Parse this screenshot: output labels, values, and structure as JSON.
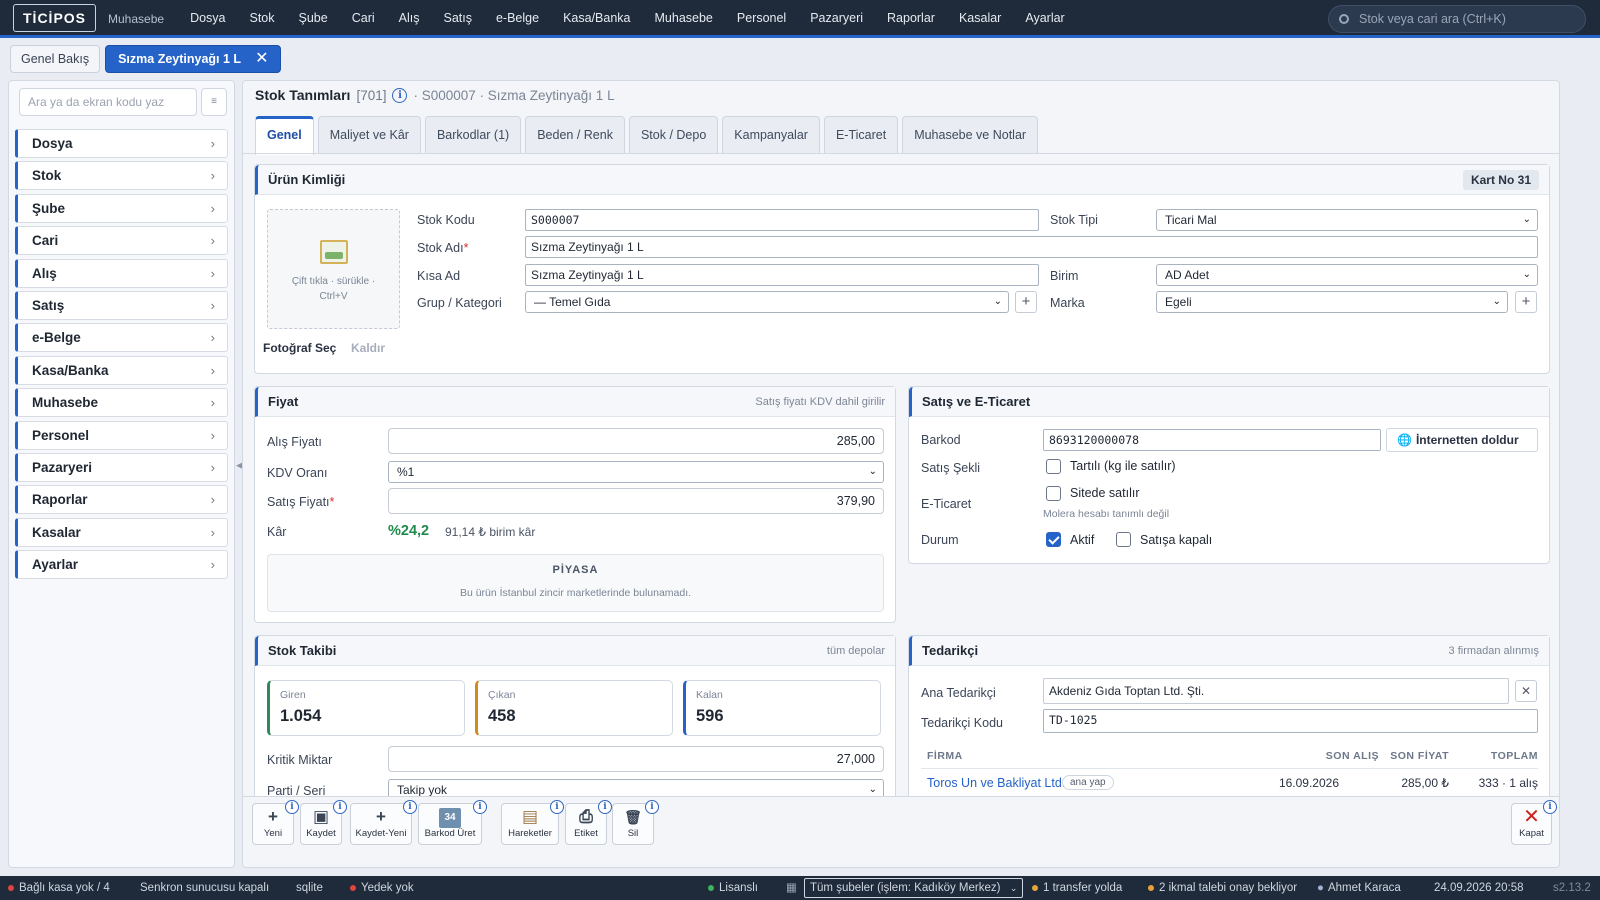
{
  "app": {
    "logo": "TİCİPOS",
    "module": "Muhasebe"
  },
  "nav": [
    "Dosya",
    "Stok",
    "Şube",
    "Cari",
    "Alış",
    "Satış",
    "e-Belge",
    "Kasa/Banka",
    "Muhasebe",
    "Personel",
    "Pazaryeri",
    "Raporlar",
    "Kasalar",
    "Ayarlar"
  ],
  "search": {
    "placeholder": "Stok veya cari ara (Ctrl+K)"
  },
  "page_tabs": [
    {
      "label": "Genel Bakış"
    },
    {
      "label": "Sızma Zeytinyağı 1 L",
      "close": "✕"
    }
  ],
  "sidebar": {
    "search_placeholder": "Ara ya da ekran kodu yaz",
    "button": "≡",
    "items": [
      "Dosya",
      "Stok",
      "Şube",
      "Cari",
      "Alış",
      "Satış",
      "e-Belge",
      "Kasa/Banka",
      "Muhasebe",
      "Personel",
      "Pazaryeri",
      "Raporlar",
      "Kasalar",
      "Ayarlar"
    ],
    "chevron": "›"
  },
  "header": {
    "title": "Stok Tanımları",
    "code": "[701]",
    "info": "i",
    "path": "· S000007 · Sızma Zeytinyağı 1 L"
  },
  "content_tabs": [
    "Genel",
    "Maliyet ve Kâr",
    "Barkodlar (1)",
    "Beden / Renk",
    "Stok / Depo",
    "Kampanyalar",
    "E-Ticaret",
    "Muhasebe ve Notlar"
  ],
  "identity": {
    "title": "Ürün Kimliği",
    "kart_no": "Kart No 31",
    "photo_hint_1": "Çift tıkla · sürükle ·",
    "photo_hint_2": "Ctrl+V",
    "photo_select": "Fotoğraf Seç",
    "photo_remove": "Kaldır",
    "stok_kodu_label": "Stok Kodu",
    "stok_kodu": "S000007",
    "stok_adi_label": "Stok Adı",
    "stok_adi": "Sızma Zeytinyağı 1 L",
    "required": "*",
    "kisa_ad_label": "Kısa Ad",
    "kisa_ad": "Sızma Zeytinyağı 1 L",
    "grup_label": "Grup / Kategori",
    "grup": "— Temel Gıda",
    "stok_tipi_label": "Stok Tipi",
    "stok_tipi": "Ticari Mal",
    "birim_label": "Birim",
    "birim": "AD Adet",
    "marka_label": "Marka",
    "marka": "Egeli",
    "plus": "+"
  },
  "price": {
    "title": "Fiyat",
    "hint": "Satış fiyatı KDV dahil girilir",
    "alis_label": "Alış Fiyatı",
    "alis": "285,00",
    "kdv_label": "KDV Oranı",
    "kdv": "%1",
    "satis_label": "Satış Fiyatı",
    "satis": "379,90",
    "kar_label": "Kâr",
    "kar_pct": "%24,2",
    "kar_unit": "91,14 ₺ birim kâr",
    "market_title": "PİYASA",
    "market_text": "Bu ürün İstanbul zincir marketlerinde bulunamadı."
  },
  "sales": {
    "title": "Satış ve E-Ticaret",
    "barkod_label": "Barkod",
    "barkod": "8693120000078",
    "internet_btn": "İnternetten doldur",
    "globe": "🌐",
    "satis_sekli_label": "Satış Şekli",
    "tartili": "Tartılı (kg ile satılır)",
    "eticaret_label": "E-Ticaret",
    "sitede": "Sitede satılır",
    "molera": "Molera hesabı tanımlı değil",
    "durum_label": "Durum",
    "aktif": "Aktif",
    "kapali": "Satışa kapalı"
  },
  "stock": {
    "title": "Stok Takibi",
    "hint": "tüm depolar",
    "giren_label": "Giren",
    "giren": "1.054",
    "cikan_label": "Çıkan",
    "cikan": "458",
    "kalan_label": "Kalan",
    "kalan": "596",
    "kritik_label": "Kritik Miktar",
    "kritik": "27,000",
    "parti_label": "Parti / Seri",
    "parti": "Takip yok",
    "colors": {
      "giren": "#2e8b57",
      "cikan": "#d08a1e",
      "kalan": "#2563c9"
    }
  },
  "supplier": {
    "title": "Tedarikçi",
    "hint": "3 firmadan alınmış",
    "ana_label": "Ana Tedarikçi",
    "ana": "Akdeniz Gıda Toptan Ltd. Şti.",
    "clear": "✕",
    "kod_label": "Tedarikçi Kodu",
    "kod": "TD-1025",
    "columns": [
      "FİRMA",
      "SON ALIŞ",
      "SON FİYAT",
      "TOPLAM"
    ],
    "rows": [
      {
        "firma": "Toros Un ve Bakliyat Ltd.",
        "badge": "ana yap",
        "son_alis": "16.09.2026",
        "son_fiyat": "285,00 ₺",
        "toplam": "333 · 1 alış"
      }
    ]
  },
  "toolbar": [
    {
      "label": "Yeni",
      "icon": "+"
    },
    {
      "label": "Kaydet",
      "icon": "▣"
    },
    {
      "label": "Kaydet-Yeni",
      "icon": "+"
    },
    {
      "label": "Barkod Üret",
      "icon": "34"
    },
    {
      "label": "Hareketler",
      "icon": "▤"
    },
    {
      "label": "Etiket",
      "icon": "⎙"
    },
    {
      "label": "Sil",
      "icon": "🗑"
    },
    {
      "label": "Kapat",
      "icon": "✕"
    }
  ],
  "toolbar_info": "i",
  "status": {
    "kasa": "Bağlı kasa yok / 4",
    "senkron": "Senkron sunucusu kapalı",
    "db": "sqlite",
    "yedek": "Yedek yok",
    "lisans": "Lisanslı",
    "sube": "Tüm şubeler (işlem: Kadıköy Merkez)",
    "transfer": "1 transfer yolda",
    "ikmal": "2 ikmal talebi onay bekliyor",
    "user": "Ahmet Karaca",
    "datetime": "24.09.2026 20:58",
    "version": "s2.13.2"
  }
}
